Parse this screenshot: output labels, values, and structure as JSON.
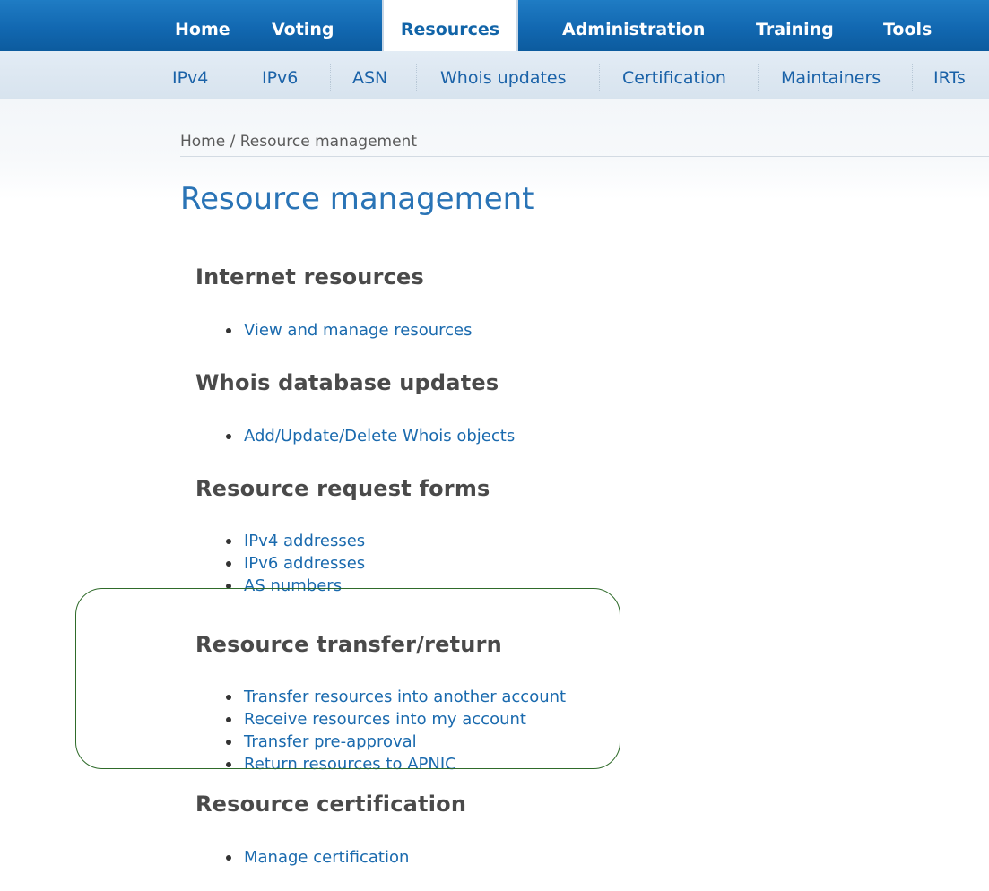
{
  "topnav": {
    "items": [
      {
        "label": "Home",
        "active": false
      },
      {
        "label": "Voting",
        "active": false
      },
      {
        "label": "Resources",
        "active": true
      },
      {
        "label": "Administration",
        "active": false
      },
      {
        "label": "Training",
        "active": false
      },
      {
        "label": "Tools",
        "active": false
      }
    ]
  },
  "subnav": {
    "items": [
      "IPv4",
      "IPv6",
      "ASN",
      "Whois updates",
      "Certification",
      "Maintainers",
      "IRTs"
    ]
  },
  "breadcrumb": {
    "home": "Home",
    "separator": " / ",
    "current": "Resource management"
  },
  "page_title": "Resource management",
  "sections": [
    {
      "heading": "Internet resources",
      "links": [
        "View and manage resources"
      ]
    },
    {
      "heading": "Whois database updates",
      "links": [
        "Add/Update/Delete Whois objects"
      ]
    },
    {
      "heading": "Resource request forms",
      "links": [
        "IPv4 addresses",
        "IPv6 addresses",
        "AS numbers"
      ]
    },
    {
      "heading": "Resource transfer/return",
      "links": [
        "Transfer resources into another account",
        "Receive resources into my account",
        "Transfer pre-approval",
        "Return resources to APNIC"
      ]
    },
    {
      "heading": "Resource certification",
      "links": [
        "Manage certification"
      ]
    }
  ],
  "colors": {
    "topnav_bg": "#1268b1",
    "subnav_bg": "#dbe5ef",
    "link": "#1a6aae",
    "title": "#2a74b6",
    "heading": "#4a4a4a",
    "annotation": "#2f6b2a"
  }
}
